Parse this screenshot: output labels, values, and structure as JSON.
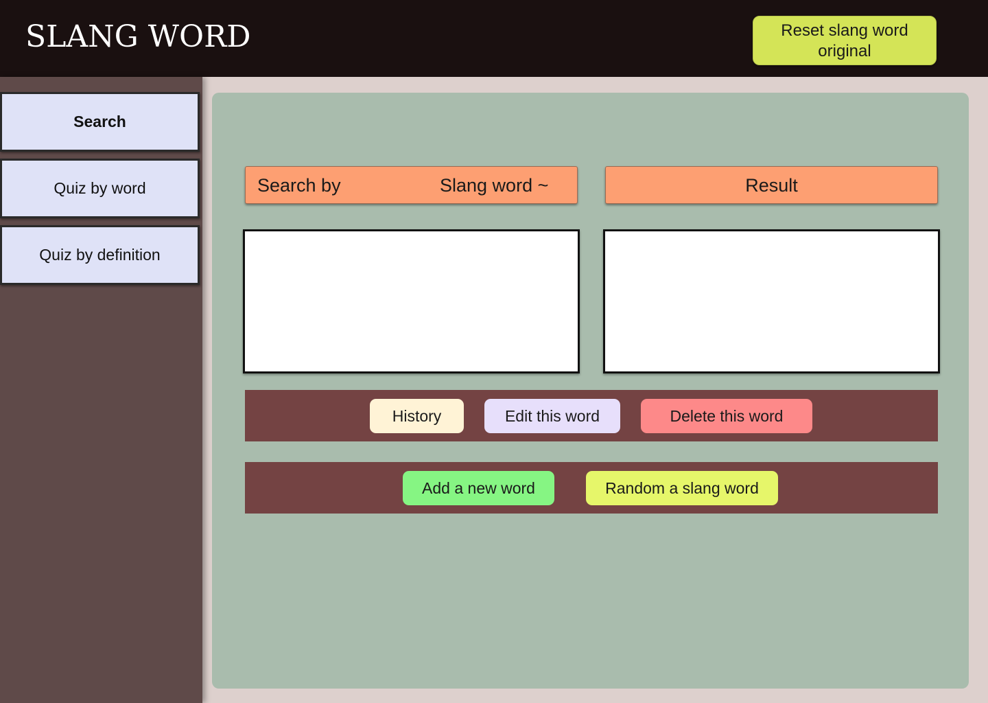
{
  "header": {
    "title": "SLANG WORD",
    "reset_button": {
      "line1": "Reset slang word",
      "line2": "original"
    }
  },
  "sidebar": {
    "items": [
      {
        "label": "Search",
        "active": true
      },
      {
        "label": "Quiz by word",
        "active": false
      },
      {
        "label": "Quiz by definition",
        "active": false
      }
    ]
  },
  "main": {
    "search_by": {
      "label": "Search by",
      "selected": "Slang word ~"
    },
    "result_label": "Result",
    "search_input_value": "",
    "result_value": "",
    "actions_row1": {
      "history": "History",
      "edit": "Edit this word",
      "delete": "Delete this word"
    },
    "actions_row2": {
      "add": "Add a new word",
      "random": "Random a slang word"
    }
  },
  "colors": {
    "header_bg": "#1a1010",
    "reset_button": "#d4e457",
    "sidebar_bg": "#5f4a49",
    "sidebar_item": "#dfe2f7",
    "main_bg": "#a9bcad",
    "bar_orange": "#fd9f72",
    "action_row_bg": "#744343",
    "history": "#fff3d6",
    "edit": "#e7dffb",
    "delete": "#fd8989",
    "add": "#86f583",
    "random": "#e6f66a"
  }
}
